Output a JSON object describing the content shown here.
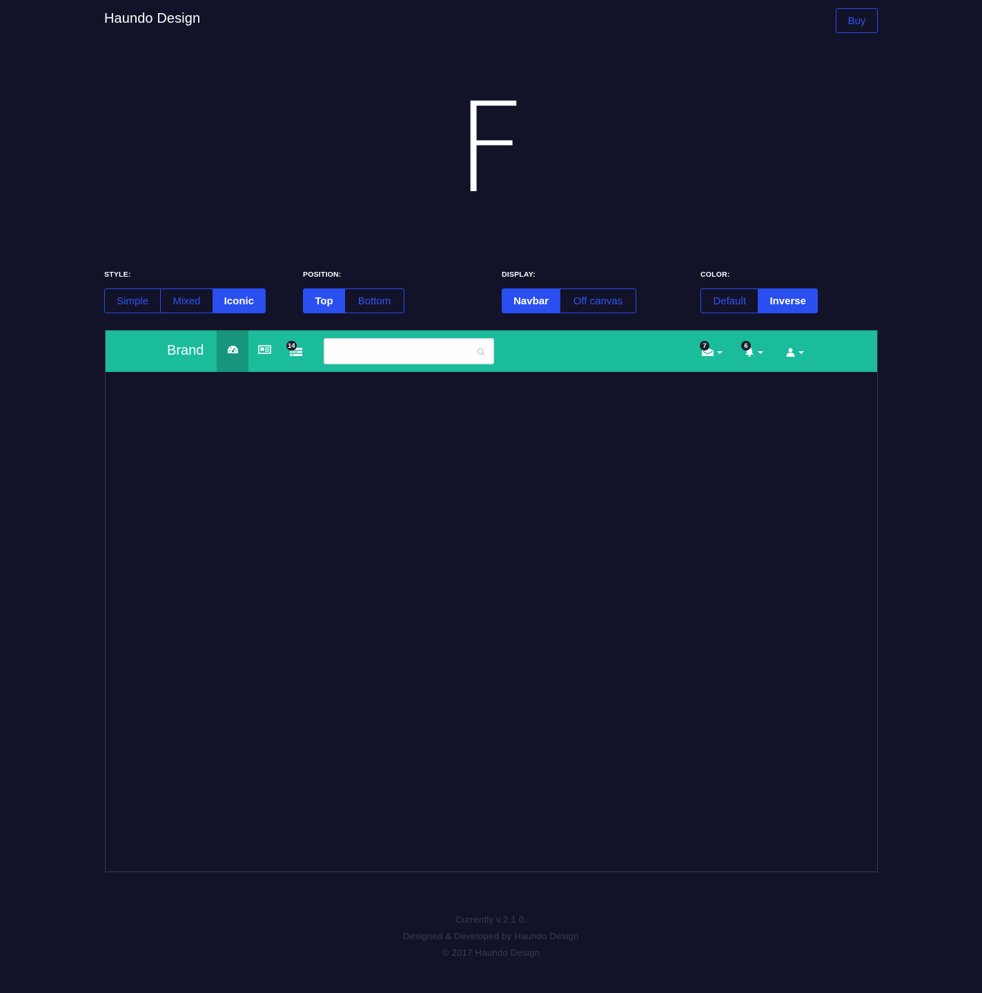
{
  "header": {
    "site_title": "Haundo Design",
    "buy_label": "Buy"
  },
  "hero": {
    "logo_letter": "F"
  },
  "options": {
    "style": {
      "label": "STYLE:",
      "buttons": [
        "Simple",
        "Mixed",
        "Iconic"
      ],
      "active": "Iconic"
    },
    "position": {
      "label": "POSITION:",
      "buttons": [
        "Top",
        "Bottom"
      ],
      "active": "Top"
    },
    "display": {
      "label": "DISPLAY:",
      "buttons": [
        "Navbar",
        "Off canvas"
      ],
      "active": "Navbar"
    },
    "color": {
      "label": "COLOR:",
      "buttons": [
        "Default",
        "Inverse"
      ],
      "active": "Inverse"
    }
  },
  "preview": {
    "navbar": {
      "brand": "Brand",
      "items": [
        {
          "icon": "dashboard-icon",
          "active": true
        },
        {
          "icon": "newspaper-icon",
          "active": false
        },
        {
          "icon": "tasks-icon",
          "badge": "14",
          "active": false
        }
      ],
      "search": {
        "value": "",
        "placeholder": ""
      },
      "right_items": [
        {
          "icon": "envelope-icon",
          "badge": "7"
        },
        {
          "icon": "bell-icon",
          "badge": "6"
        },
        {
          "icon": "user-icon"
        }
      ]
    }
  },
  "footer": {
    "version": "Currently v.2.1.0.",
    "credit": "Designed & Developed by Haundo Design",
    "copyright": "© 2017 Haundo Design"
  },
  "colors": {
    "background": "#121228",
    "accent": "#2a4ff0",
    "navbar": "#1abc9c",
    "navbar_active": "#17967d"
  }
}
